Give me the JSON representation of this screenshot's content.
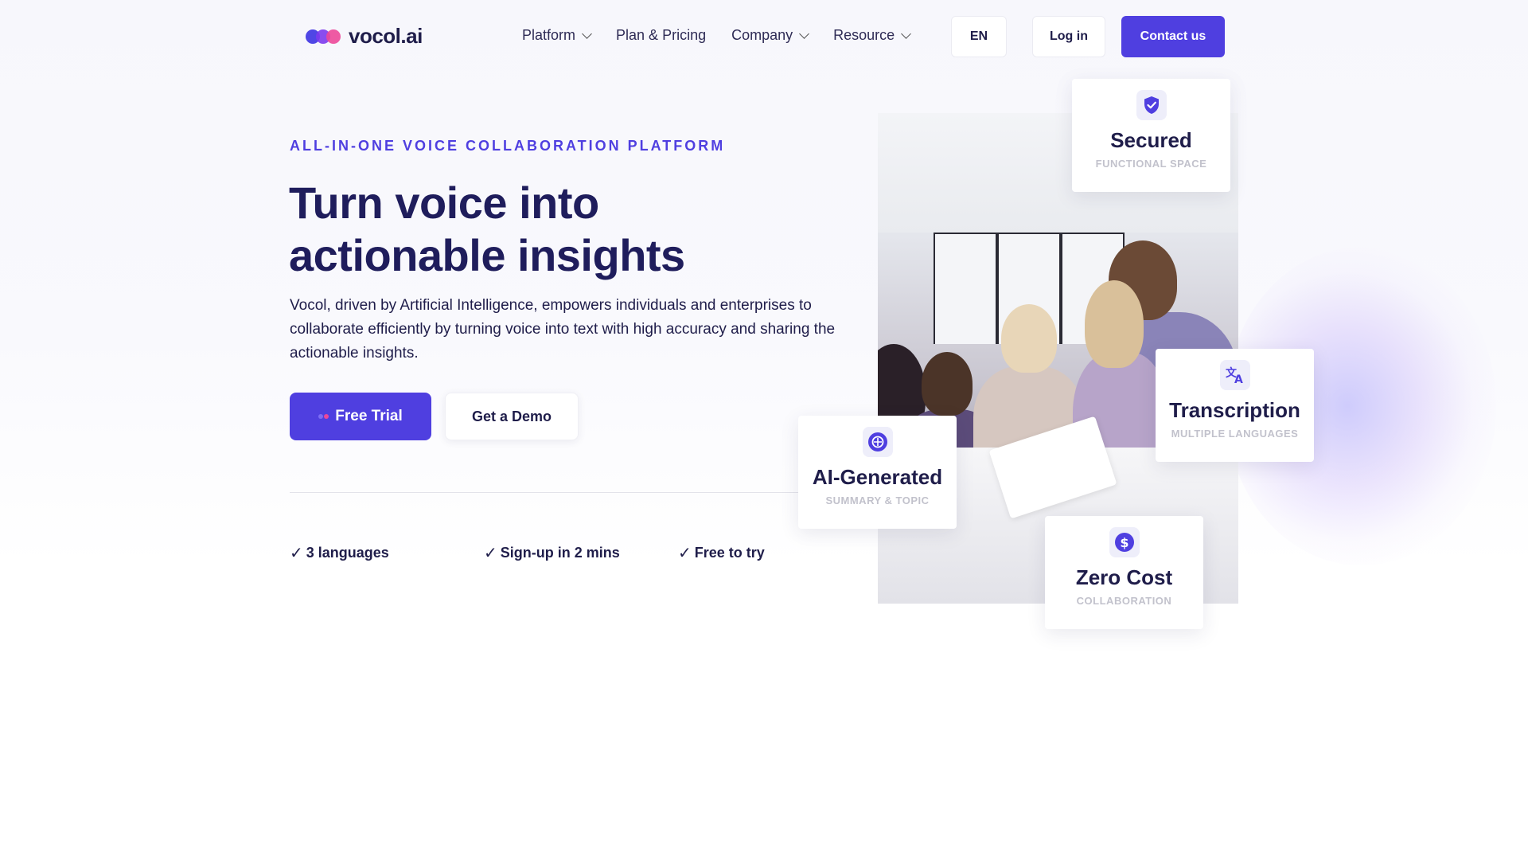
{
  "brand": {
    "logo_text": "vocol.ai",
    "accent": "#4f3fe0",
    "dark": "#1f1d5c"
  },
  "nav": {
    "items": [
      {
        "label": "Platform",
        "has_dropdown": true
      },
      {
        "label": "Plan & Pricing",
        "has_dropdown": false
      },
      {
        "label": "Company",
        "has_dropdown": true
      },
      {
        "label": "Resource",
        "has_dropdown": true
      }
    ],
    "language": "EN",
    "login_label": "Log in",
    "contact_label": "Contact us"
  },
  "hero": {
    "eyebrow": "ALL-IN-ONE VOICE COLLABORATION PLATFORM",
    "headline": "Turn voice into actionable insights",
    "description": "Vocol, driven by Artificial Intelligence, empowers individuals and enterprises to collaborate efficiently by turning voice into text with high accuracy and sharing the actionable insights.",
    "primary_cta": "Free Trial",
    "secondary_cta": "Get a Demo",
    "features": [
      "3 languages",
      "Sign-up in 2 mins",
      "Free to try"
    ],
    "check_glyph": "✓"
  },
  "cards": {
    "secured": {
      "title": "Secured",
      "subtitle": "FUNCTIONAL SPACE",
      "icon": "shield-check-icon"
    },
    "transcription": {
      "title": "Transcription",
      "subtitle": "MULTIPLE LANGUAGES",
      "icon": "translate-icon"
    },
    "ai_generated": {
      "title": "AI-Generated",
      "subtitle": "SUMMARY & TOPIC",
      "icon": "ai-chip-icon"
    },
    "zero_cost": {
      "title": "Zero Cost",
      "subtitle": "COLLABORATION",
      "icon": "dollar-icon"
    }
  }
}
